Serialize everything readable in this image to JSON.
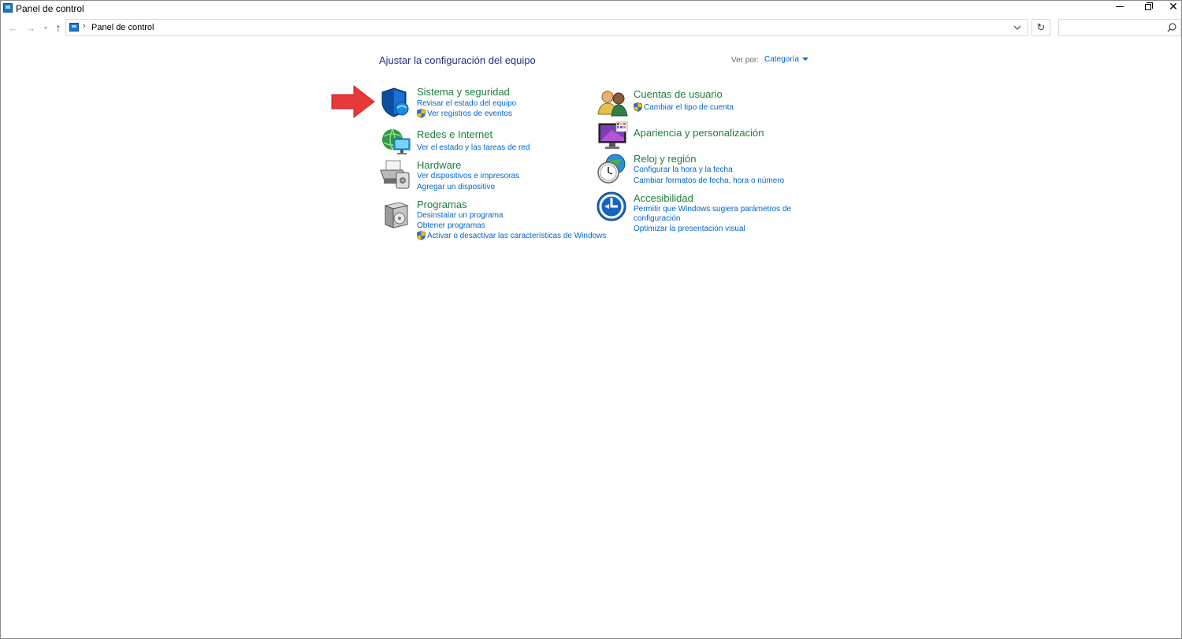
{
  "window": {
    "title": "Panel de control"
  },
  "address": {
    "separator": "›",
    "path": "Panel de control"
  },
  "search": {
    "placeholder": ""
  },
  "content": {
    "heading": "Ajustar la configuración del equipo",
    "view_by_label": "Ver por:",
    "view_by_value": "Categoría"
  },
  "categories": {
    "system": {
      "title": "Sistema y seguridad",
      "links": [
        "Revisar el estado del equipo",
        "Ver registros de eventos"
      ],
      "icon": "shield-icon"
    },
    "network": {
      "title": "Redes e Internet",
      "links": [
        "Ver el estado y las tareas de red"
      ],
      "icon": "network-globe-icon"
    },
    "hardware": {
      "title": "Hardware",
      "links": [
        "Ver dispositivos e impresoras",
        "Agregar un dispositivo"
      ],
      "icon": "printer-icon"
    },
    "programs": {
      "title": "Programas",
      "links": [
        "Desinstalar un programa",
        "Obtener programas",
        "Activar o desactivar las características de Windows"
      ],
      "icon": "programs-box-icon"
    },
    "users": {
      "title": "Cuentas de usuario",
      "links": [
        "Cambiar el tipo de cuenta"
      ],
      "icon": "users-icon"
    },
    "appearance": {
      "title": "Apariencia y personalización",
      "links": [],
      "icon": "monitor-palette-icon"
    },
    "clock": {
      "title": "Reloj y región",
      "links": [
        "Configurar la hora y la fecha",
        "Cambiar formatos de fecha, hora o número"
      ],
      "icon": "clock-globe-icon"
    },
    "accessibility": {
      "title": "Accesibilidad",
      "links": [
        "Permitir que Windows sugiera parámetros de configuración",
        "Optimizar la presentación visual"
      ],
      "link_lines": [
        "Permitir que Windows sugiera parámetros de",
        "configuración"
      ],
      "icon": "accessibility-icon"
    }
  },
  "colors": {
    "heading": "#1e3287",
    "category_title": "#1c7f3a",
    "link": "#0066cc",
    "arrow": "#e8383a"
  }
}
